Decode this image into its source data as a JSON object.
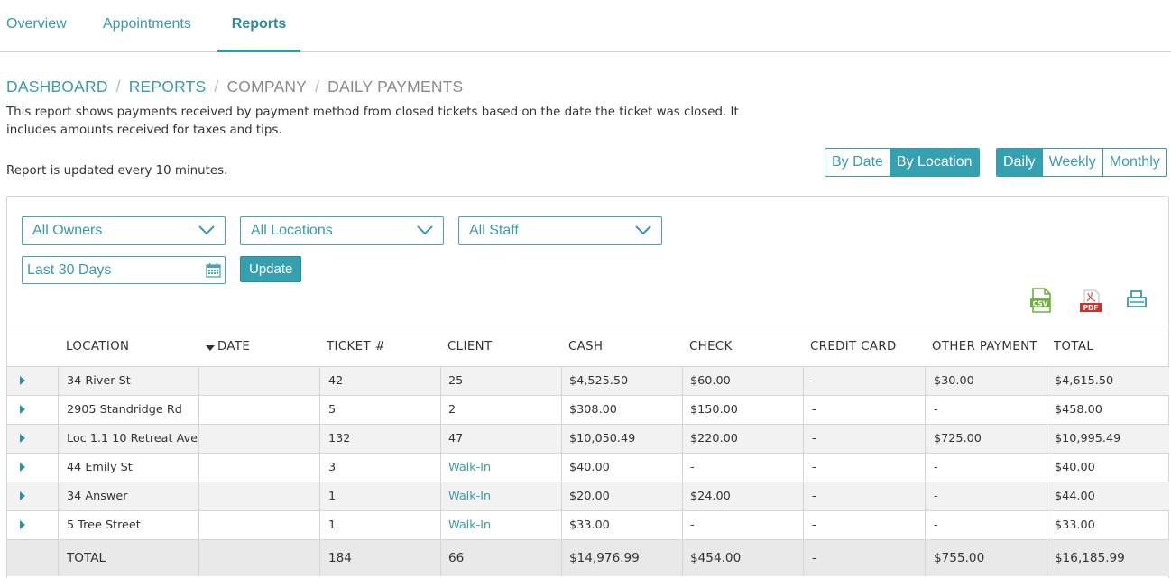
{
  "tabs": [
    {
      "label": "Overview"
    },
    {
      "label": "Appointments"
    },
    {
      "label": "Reports",
      "active": true
    }
  ],
  "breadcrumb": [
    {
      "label": "DASHBOARD"
    },
    {
      "label": "REPORTS"
    },
    {
      "label": "COMPANY"
    },
    {
      "label": "DAILY PAYMENTS"
    }
  ],
  "description": "This report shows payments received by payment method from closed tickets based on the date the ticket was closed. It includes amounts received for taxes and tips.",
  "update_note": "Report is updated every 10 minutes.",
  "group_toggle": {
    "by_date": "By Date",
    "by_location": "By Location",
    "selected": "By Location"
  },
  "period_toggle": {
    "daily": "Daily",
    "weekly": "Weekly",
    "monthly": "Monthly",
    "selected": "Daily"
  },
  "filters": {
    "owners": "All Owners",
    "locations": "All Locations",
    "staff": "All Staff",
    "date_range": "Last 30 Days",
    "update_label": "Update"
  },
  "export": {
    "csv_text": "CSV",
    "pdf_text": "PDF"
  },
  "colors": {
    "accent": "#35a0b0",
    "link": "#3a9aaa",
    "csv_icon": "#6cb33f",
    "pdf_icon": "#d32f2f"
  },
  "table": {
    "columns": {
      "location": "LOCATION",
      "date": "DATE",
      "ticket": "TICKET #",
      "client": "CLIENT",
      "cash": "CASH",
      "check": "CHECK",
      "credit_card": "CREDIT CARD",
      "other_payment": "OTHER PAYMENT",
      "total": "TOTAL"
    },
    "rows": [
      {
        "location": "34 River St",
        "date": "",
        "ticket": "42",
        "client": "25",
        "cash": "$4,525.50",
        "check": "$60.00",
        "credit_card": "-",
        "other_payment": "$30.00",
        "total": "$4,615.50"
      },
      {
        "location": "2905 Standridge Rd",
        "date": "",
        "ticket": "5",
        "client": "2",
        "cash": "$308.00",
        "check": "$150.00",
        "credit_card": "-",
        "other_payment": "-",
        "total": "$458.00"
      },
      {
        "location": "Loc 1.1 10 Retreat Ave",
        "date": "",
        "ticket": "132",
        "client": "47",
        "cash": "$10,050.49",
        "check": "$220.00",
        "credit_card": "-",
        "other_payment": "$725.00",
        "total": "$10,995.49"
      },
      {
        "location": "44 Emily St",
        "date": "",
        "ticket": "3",
        "client": "Walk-In",
        "cash": "$40.00",
        "check": "-",
        "credit_card": "-",
        "other_payment": "-",
        "total": "$40.00"
      },
      {
        "location": "34 Answer",
        "date": "",
        "ticket": "1",
        "client": "Walk-In",
        "cash": "$20.00",
        "check": "$24.00",
        "credit_card": "-",
        "other_payment": "-",
        "total": "$44.00"
      },
      {
        "location": "5 Tree Street",
        "date": "",
        "ticket": "1",
        "client": "Walk-In",
        "cash": "$33.00",
        "check": "-",
        "credit_card": "-",
        "other_payment": "-",
        "total": "$33.00"
      }
    ],
    "totals": {
      "location": "TOTAL",
      "date": "",
      "ticket": "184",
      "client": "66",
      "cash": "$14,976.99",
      "check": "$454.00",
      "credit_card": "-",
      "other_payment": "$755.00",
      "total": "$16,185.99"
    }
  }
}
